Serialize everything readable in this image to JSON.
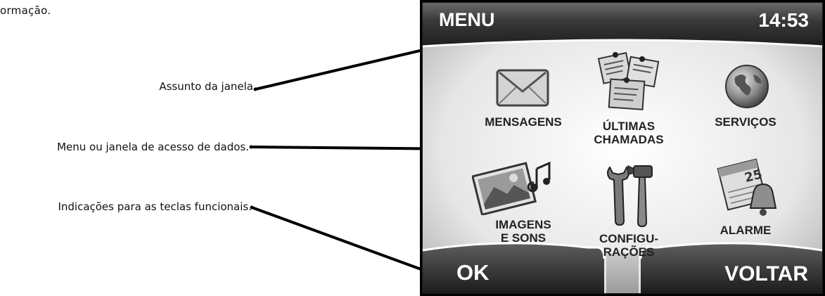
{
  "page_fragment": "ormação.",
  "callouts": [
    {
      "label": "Assunto da janela"
    },
    {
      "label": "Menu ou janela de acesso de dados."
    },
    {
      "label": "Indicações para as teclas funcionais."
    }
  ],
  "display": {
    "title": "MENU",
    "time": "14:53",
    "softkeys": {
      "left": "OK",
      "right": "VOLTAR"
    },
    "apps": [
      {
        "label": "MENSAGENS",
        "icon": "envelope-icon"
      },
      {
        "label": "ÚLTIMAS\nCHAMADAS",
        "icon": "call-notes-icon"
      },
      {
        "label": "SERVIÇOS",
        "icon": "globe-icon"
      },
      {
        "label": "IMAGENS\nE SONS",
        "icon": "pictures-music-icon"
      },
      {
        "label": "CONFIGU-\nRAÇÕES",
        "icon": "tools-icon"
      },
      {
        "label": "ALARME",
        "icon": "calendar-bell-icon"
      }
    ]
  }
}
